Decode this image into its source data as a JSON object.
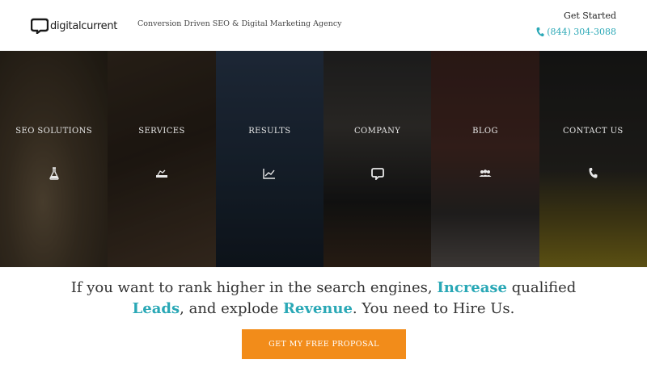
{
  "header": {
    "logo_text": "digitalcurrent",
    "tagline": "Conversion Driven SEO & Digital Marketing Agency",
    "get_started": "Get Started",
    "phone": "(844) 304-3088"
  },
  "nav": {
    "panels": [
      {
        "label": "SEO SOLUTIONS",
        "icon": "flask-icon"
      },
      {
        "label": "SERVICES",
        "icon": "services-icon"
      },
      {
        "label": "RESULTS",
        "icon": "line-chart-icon"
      },
      {
        "label": "COMPANY",
        "icon": "logo-bubble-icon"
      },
      {
        "label": "BLOG",
        "icon": "people-icon"
      },
      {
        "label": "CONTACT US",
        "icon": "phone-icon"
      }
    ]
  },
  "cta": {
    "line1_pre": "If you want to rank higher in the search engines, ",
    "line1_hl": "Increase",
    "line1_post": " qualified",
    "line2_hl1": "Leads",
    "line2_mid": ", and explode ",
    "line2_hl2": "Revenue",
    "line2_post": ". You need to Hire Us.",
    "button_label": "GET MY FREE PROPOSAL"
  },
  "colors": {
    "accent": "#2aa8b6",
    "button": "#f28c1a"
  }
}
